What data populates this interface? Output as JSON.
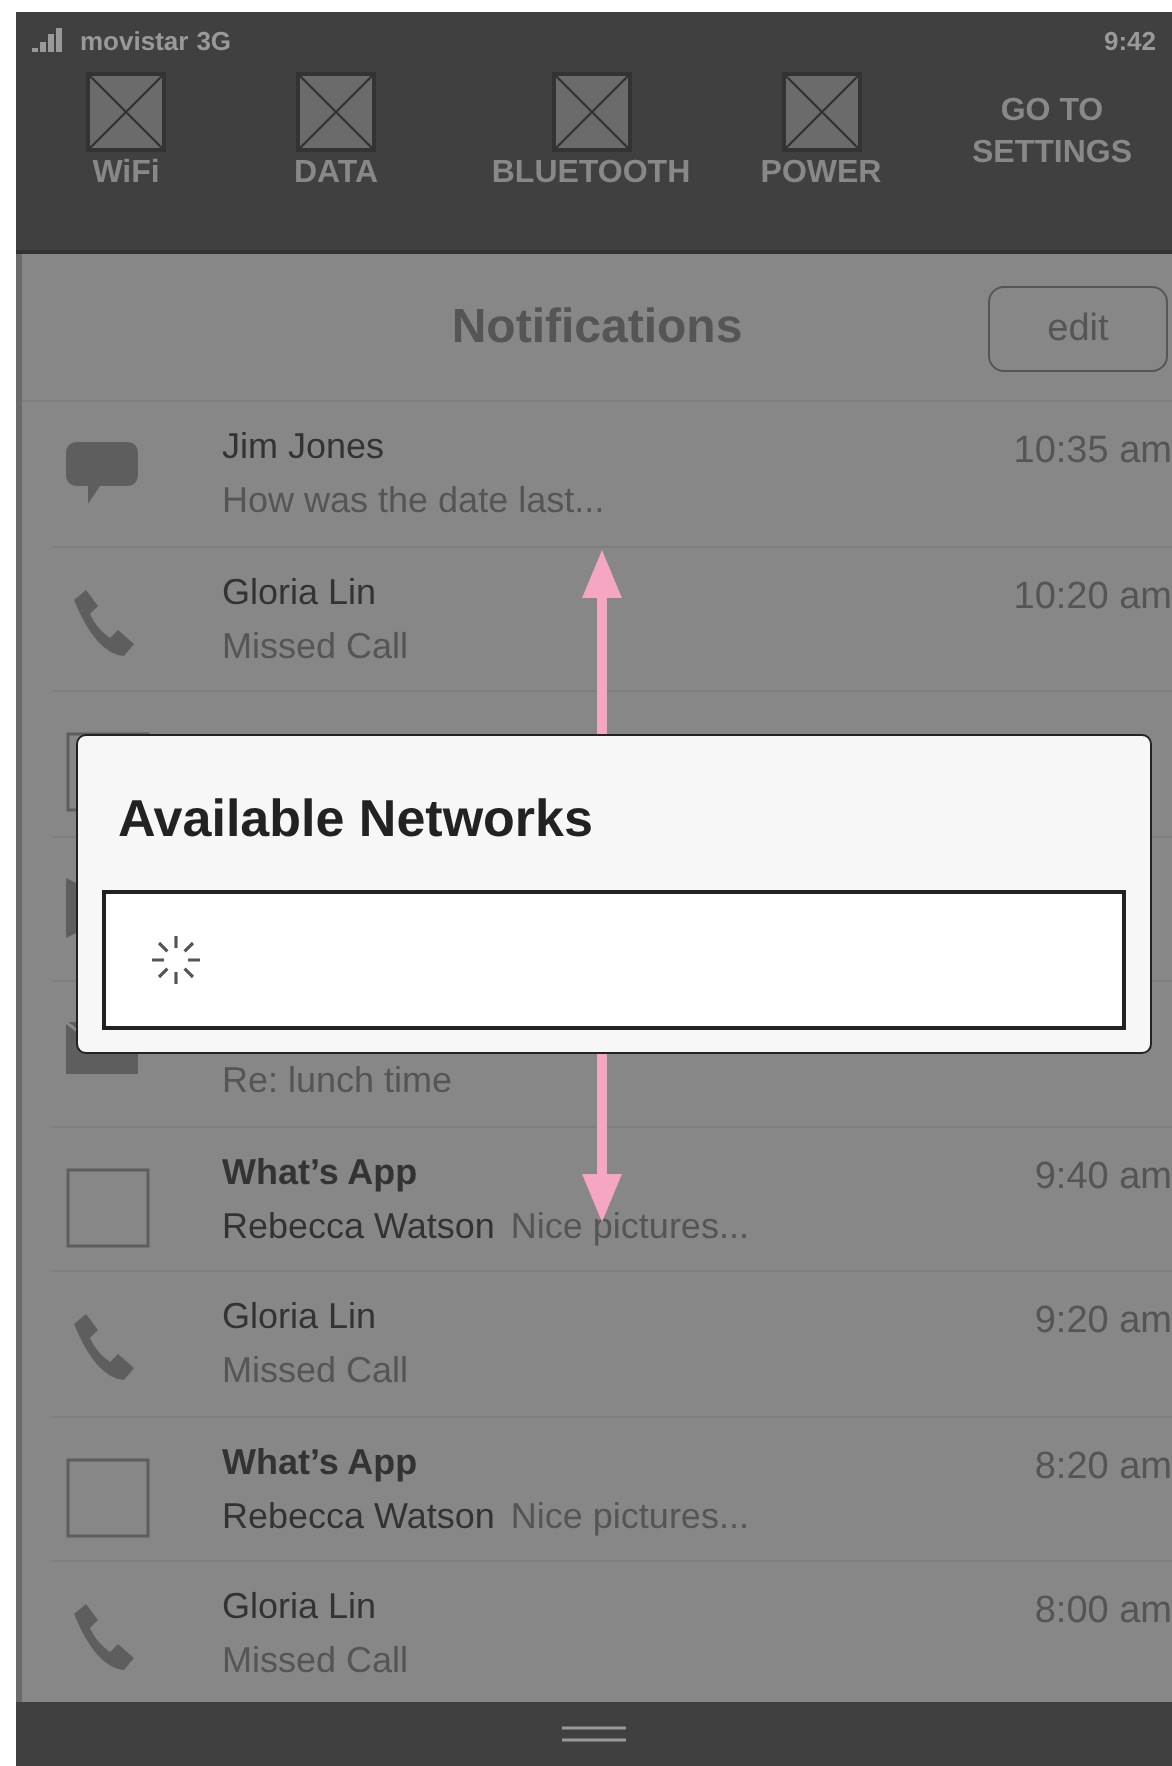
{
  "status_bar": {
    "carrier": "movistar",
    "network": "3G",
    "time": "9:42"
  },
  "quick_toggles": [
    {
      "label": "WiFi"
    },
    {
      "label": "DATA"
    },
    {
      "label": "BLUETOOTH"
    },
    {
      "label": "POWER"
    }
  ],
  "settings_button": {
    "label": "GO TO SETTINGS"
  },
  "header": {
    "title": "Notifications",
    "edit_button": "edit"
  },
  "notifications": [
    {
      "kind": "message",
      "title": "Jim Jones",
      "bold": false,
      "subtitle": "How was the date last...",
      "time": "10:35 am"
    },
    {
      "kind": "call",
      "title": "Gloria Lin",
      "bold": false,
      "subtitle": "Missed Call",
      "time": "10:20 am"
    },
    {
      "kind": "app"
    },
    {
      "kind": "video"
    },
    {
      "kind": "mail",
      "subtitle": "Re: lunch time"
    },
    {
      "kind": "app",
      "title": "What’s App",
      "bold": true,
      "sender": "Rebecca Watson",
      "subtitle": "Nice pictures...",
      "time": "9:40 am"
    },
    {
      "kind": "call",
      "title": "Gloria Lin",
      "bold": false,
      "subtitle": "Missed Call",
      "time": "9:20 am"
    },
    {
      "kind": "app",
      "title": "What’s App",
      "bold": true,
      "sender": "Rebecca Watson",
      "subtitle": "Nice pictures...",
      "time": "8:20 am"
    },
    {
      "kind": "call",
      "title": "Gloria Lin",
      "bold": false,
      "subtitle": "Missed Call",
      "time": "8:00 am"
    }
  ],
  "dialog": {
    "title": "Available Networks",
    "loading": true
  }
}
